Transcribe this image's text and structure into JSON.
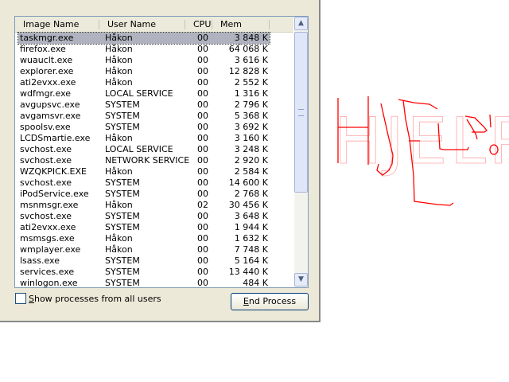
{
  "columns": [
    "Image Name",
    "User Name",
    "CPU",
    "Mem Usage"
  ],
  "rows": [
    [
      "taskmgr.exe",
      "Håkon",
      "00",
      "3 848 K"
    ],
    [
      "firefox.exe",
      "Håkon",
      "00",
      "64 068 K"
    ],
    [
      "wuauclt.exe",
      "Håkon",
      "00",
      "3 616 K"
    ],
    [
      "explorer.exe",
      "Håkon",
      "00",
      "12 828 K"
    ],
    [
      "ati2evxx.exe",
      "Håkon",
      "00",
      "2 552 K"
    ],
    [
      "wdfmgr.exe",
      "LOCAL SERVICE",
      "00",
      "1 316 K"
    ],
    [
      "avgupsvc.exe",
      "SYSTEM",
      "00",
      "2 796 K"
    ],
    [
      "avgamsvr.exe",
      "SYSTEM",
      "00",
      "5 368 K"
    ],
    [
      "spoolsv.exe",
      "SYSTEM",
      "00",
      "3 692 K"
    ],
    [
      "LCDSmartie.exe",
      "Håkon",
      "00",
      "3 160 K"
    ],
    [
      "svchost.exe",
      "LOCAL SERVICE",
      "00",
      "3 248 K"
    ],
    [
      "svchost.exe",
      "NETWORK SERVICE",
      "00",
      "2 920 K"
    ],
    [
      "WZQKPICK.EXE",
      "Håkon",
      "00",
      "2 584 K"
    ],
    [
      "svchost.exe",
      "SYSTEM",
      "00",
      "14 600 K"
    ],
    [
      "iPodService.exe",
      "SYSTEM",
      "00",
      "2 768 K"
    ],
    [
      "msnmsgr.exe",
      "Håkon",
      "02",
      "30 456 K"
    ],
    [
      "svchost.exe",
      "SYSTEM",
      "00",
      "3 648 K"
    ],
    [
      "ati2evxx.exe",
      "SYSTEM",
      "00",
      "1 944 K"
    ],
    [
      "msmsgs.exe",
      "Håkon",
      "00",
      "1 632 K"
    ],
    [
      "wmplayer.exe",
      "Håkon",
      "00",
      "7 748 K"
    ],
    [
      "lsass.exe",
      "SYSTEM",
      "00",
      "5 164 K"
    ],
    [
      "services.exe",
      "SYSTEM",
      "00",
      "13 440 K"
    ],
    [
      "winlogon.exe",
      "SYSTEM",
      "00",
      "484 K"
    ]
  ],
  "selected_row": 0,
  "show_all": {
    "first": "S",
    "rest": "how processes from all users",
    "checked": false
  },
  "end_process": {
    "first": "E",
    "rest": "nd Process"
  },
  "scroll": {
    "up": "▲",
    "down": "▼"
  },
  "scribble": {
    "text": "HJELP!",
    "color": "#ff0000"
  }
}
